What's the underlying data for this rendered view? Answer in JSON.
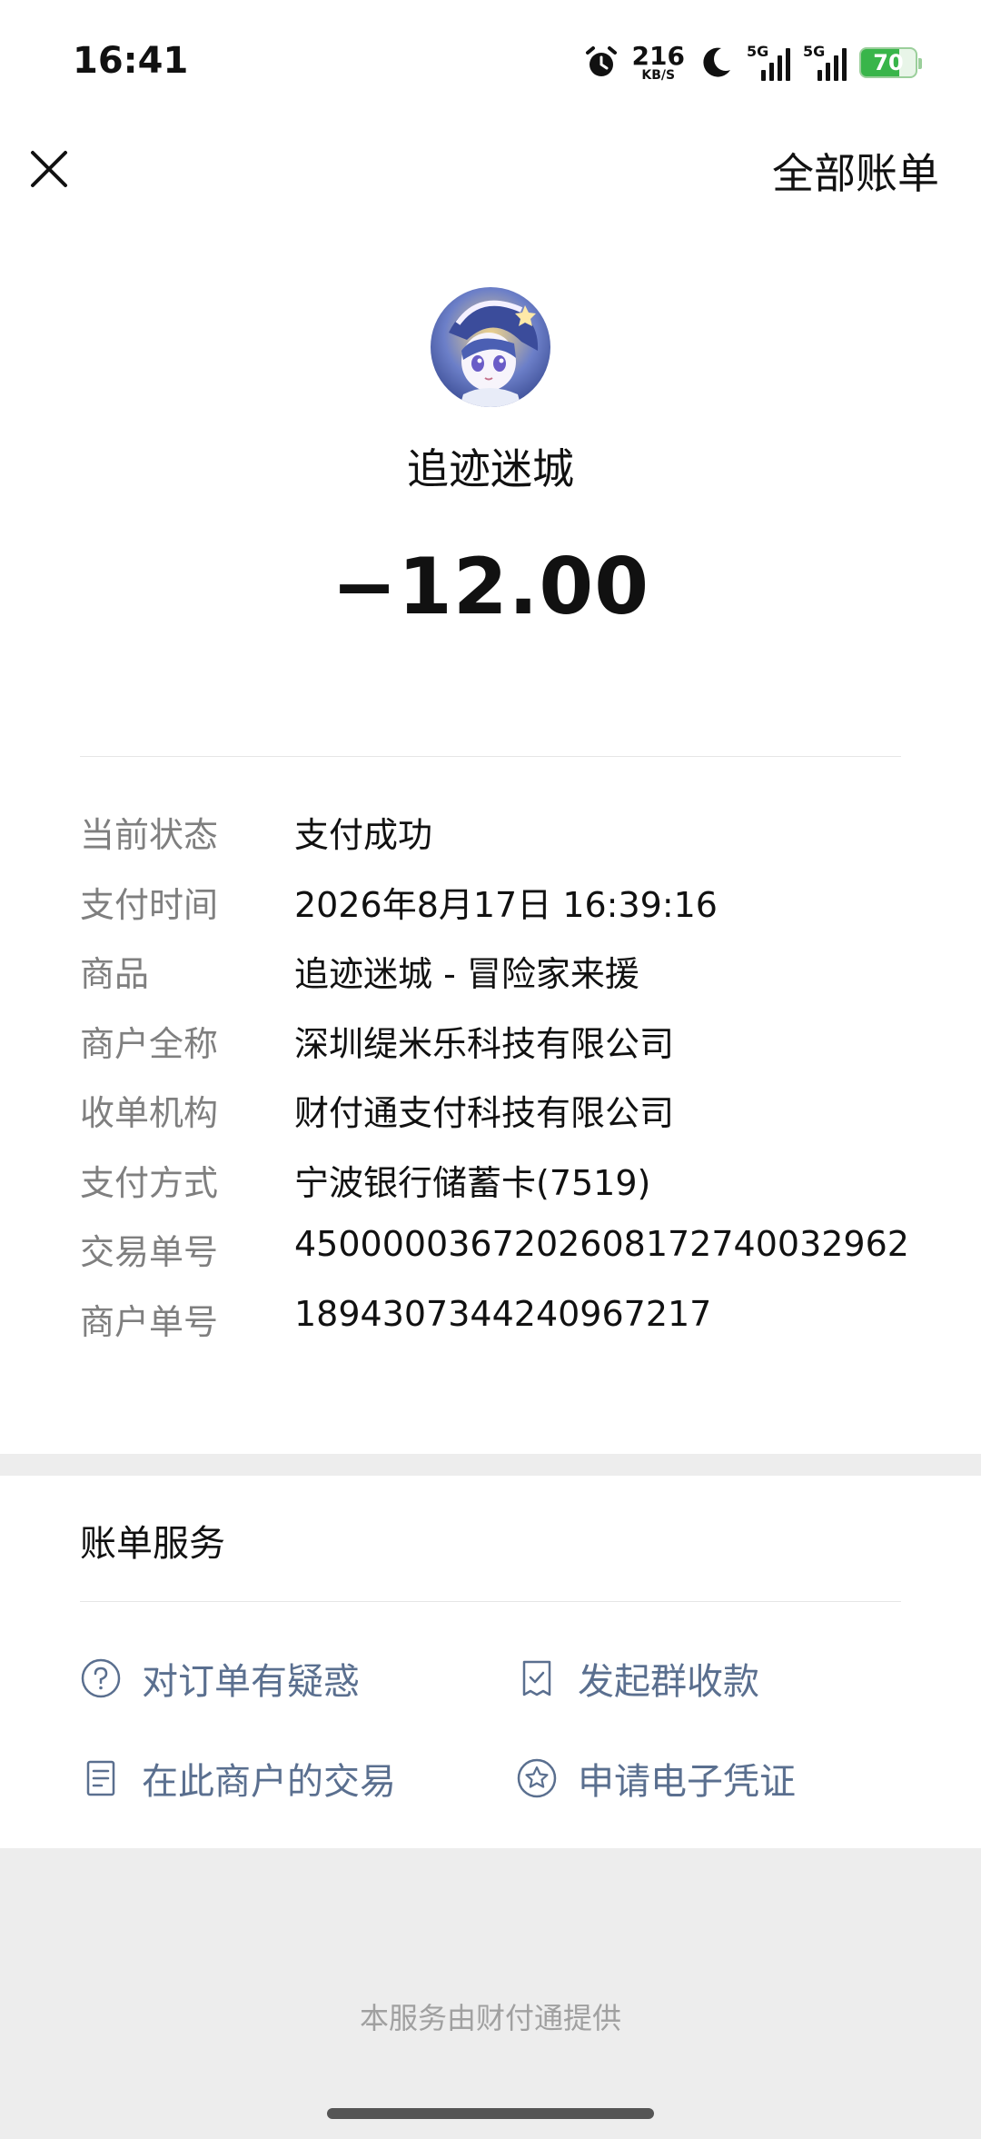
{
  "status_bar": {
    "time": "16:41",
    "net_speed": "216",
    "net_speed_unit": "KB/S",
    "signal1_label": "5G",
    "signal2_label": "5G",
    "battery": "70",
    "icons": [
      "alarm-icon",
      "moon-icon",
      "signal-icon",
      "signal-icon",
      "battery-icon"
    ]
  },
  "header": {
    "close_icon": "close-icon",
    "all_bills": "全部账单"
  },
  "merchant": {
    "name": "追迹迷城",
    "amount": "−12.00"
  },
  "details": [
    {
      "label": "当前状态",
      "value": "支付成功"
    },
    {
      "label": "支付时间",
      "value": "2026年8月17日 16:39:16"
    },
    {
      "label": "商品",
      "value": "追迹迷城 - 冒险家来援"
    },
    {
      "label": "商户全称",
      "value": "深圳缇米乐科技有限公司"
    },
    {
      "label": "收单机构",
      "value": "财付通支付科技有限公司"
    },
    {
      "label": "支付方式",
      "value": "宁波银行储蓄卡(7519)"
    },
    {
      "label": "交易单号",
      "value": "4500000367202608172740032962"
    },
    {
      "label": "商户单号",
      "value": "1894307344240967217"
    }
  ],
  "services": {
    "title": "账单服务",
    "items": [
      {
        "label": "对订单有疑惑",
        "icon": "question-icon"
      },
      {
        "label": "发起群收款",
        "icon": "group-collect-icon"
      },
      {
        "label": "在此商户的交易",
        "icon": "document-icon"
      },
      {
        "label": "申请电子凭证",
        "icon": "star-badge-icon"
      }
    ]
  },
  "footer": "本服务由财付通提供",
  "colors": {
    "link": "#5a6f8f",
    "label": "#7f7f7f",
    "background": "#ededed"
  }
}
